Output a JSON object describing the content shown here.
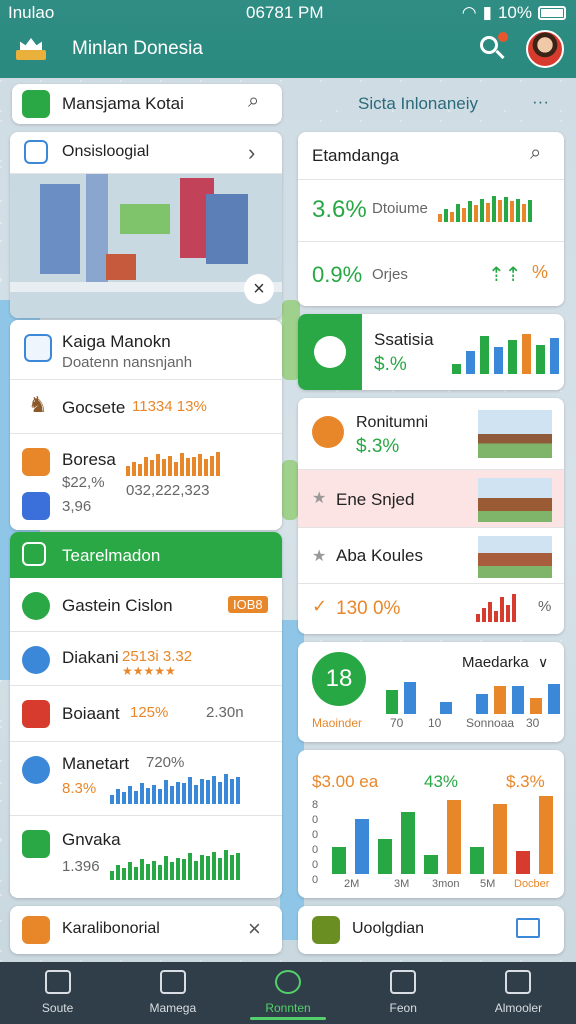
{
  "status_bar": {
    "carrier": "Inulao",
    "time": "06781 PM",
    "battery": "10%"
  },
  "header": {
    "title": "Minlan Donesia"
  },
  "left": {
    "search_card": {
      "title": "Mansjama Kotai"
    },
    "map_card": {
      "title": "Onsisloogial"
    },
    "list": [
      {
        "title": "Kaiga Manokn",
        "sub": "Doatenn nansnjanh"
      },
      {
        "title": "Gocsete",
        "value": "11334 13%"
      },
      {
        "title": "Boresa",
        "value": "$22,%",
        "value2": "032,222,323",
        "value3": "3,96"
      },
      {
        "title": "Tearelmadon"
      },
      {
        "title": "Gastein Cislon",
        "badge": "IOB8"
      },
      {
        "title": "Diakani",
        "value": "2513i 3.32"
      },
      {
        "title": "Boiaant",
        "value": "125%",
        "value2": "2.30n"
      },
      {
        "title": "Manetart",
        "value": "720%",
        "value2": "8.3%"
      },
      {
        "title": "Gnvaka",
        "value": "1.396"
      }
    ],
    "bottom_card": {
      "title": "Karalibonorial"
    }
  },
  "right": {
    "header": {
      "title": "Sicta Inlonaneiy",
      "more": "···"
    },
    "search_card": {
      "title": "Etamdanga"
    },
    "metrics": [
      {
        "value": "3.6%",
        "label": "Dtoiume"
      },
      {
        "value": "0.9%",
        "label": "Orjes",
        "delta": "%"
      }
    ],
    "stats_card": {
      "title": "Ssatisia",
      "value": "$.%"
    },
    "places": [
      {
        "title": "Ronitumni",
        "value": "$.3%"
      },
      {
        "title": "Ene Snjed"
      },
      {
        "title": "Aba Koules"
      },
      {
        "value": "130 0%"
      }
    ],
    "mini_chart": {
      "badge": "18",
      "title": "Maedarka",
      "badge_label": "Maoinder",
      "labels": [
        "70",
        "10",
        "Sonnoaa",
        "30"
      ]
    },
    "big_chart": {
      "labels": [
        "$3.00 ea",
        "43%",
        "$.3%"
      ],
      "x_labels": [
        "2M",
        "3M",
        "3mon",
        "5M",
        "Docber"
      ]
    },
    "bottom_card": {
      "title": "Uoolgdian"
    }
  },
  "nav": [
    {
      "label": "Soute",
      "icon": "home-icon"
    },
    {
      "label": "Mamega",
      "icon": "store-icon"
    },
    {
      "label": "Ronnten",
      "icon": "pin-icon",
      "active": true
    },
    {
      "label": "Feon",
      "icon": "list-icon"
    },
    {
      "label": "Almooler",
      "icon": "shop-icon"
    }
  ],
  "colors": {
    "header": "#2f8d84",
    "green": "#27a844",
    "orange": "#e8872a",
    "nav": "#2f3e48"
  }
}
